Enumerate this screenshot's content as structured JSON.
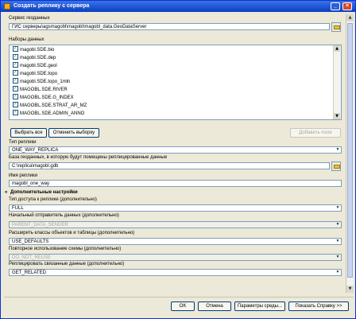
{
  "window": {
    "title": "Создать реплику с сервера"
  },
  "geodata_service": {
    "label": "Сервис геоданных",
    "value": "ГИС серверы\\agsmagobl\\magobl\\magobl_data.GeoDataServer"
  },
  "datasets": {
    "label": "Наборы данных",
    "items": [
      {
        "name": "magobl.SDE.bio",
        "checked": true
      },
      {
        "name": "magobl.SDE.dep",
        "checked": true
      },
      {
        "name": "magobl.SDE.geol",
        "checked": true
      },
      {
        "name": "magobl.SDE.topo",
        "checked": true
      },
      {
        "name": "magobl.SDE.topo_1mln",
        "checked": true
      },
      {
        "name": "MAGOBL.SDE.RIVER",
        "checked": true
      },
      {
        "name": "MAGOBL.SDE.G_INDEX",
        "checked": true
      },
      {
        "name": "MAGOBL.SDE.STRAT_AR_MZ",
        "checked": true
      },
      {
        "name": "MAGOBL.SDE.ADMIN_ANNO",
        "checked": true
      }
    ]
  },
  "buttons": {
    "select_all": "Выбрать все",
    "clear_selection": "Отменить выборку",
    "add_field": "Добавить поле"
  },
  "replica_type": {
    "label": "Тип реплики",
    "value": "ONE_WAY_REPLICA"
  },
  "target_gdb": {
    "label": "База геоданных, в которую будут помещены реплицированные данные",
    "value": "C:\\replica\\magobl.gdb"
  },
  "replica_name": {
    "label": "Имя реплики",
    "value": "magobl_one_way"
  },
  "advanced": {
    "label": "Дополнительные настройки"
  },
  "access_type": {
    "label": "Тип доступа к реплике (дополнительно)",
    "value": "FULL"
  },
  "initial_sender": {
    "label": "Начальный отправитель данных (дополнительно)",
    "value": "PARENT_DATA_SENDER"
  },
  "expand_classes": {
    "label": "Расширить классы объектов и таблицы (дополнительно)",
    "value": "USE_DEFAULTS"
  },
  "reuse_schema": {
    "label": "Повторное использование схемы (дополнительно)",
    "value": "DO_NOT_REUSE"
  },
  "related_data": {
    "label": "Реплицировать связанные данные (дополнительно)",
    "value": "GET_RELATED"
  },
  "footer": {
    "ok": "OK",
    "cancel": "Отмена",
    "environments": "Параметры среды...",
    "show_help": "Показать Справку >>"
  }
}
